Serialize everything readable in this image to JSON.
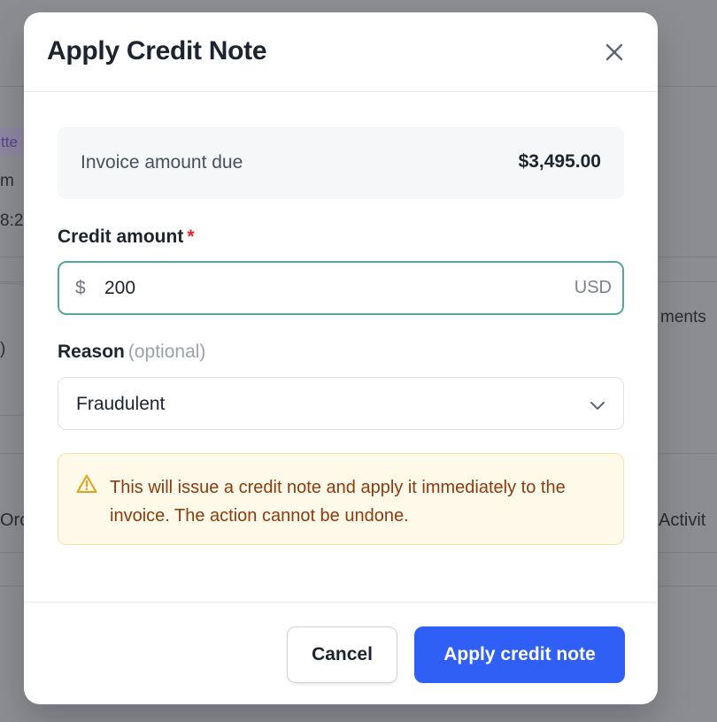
{
  "background": {
    "fragments": [
      "tte",
      "m",
      "8:2",
      ")",
      "Orc",
      "ments",
      "Activit"
    ]
  },
  "modal": {
    "title": "Apply Credit Note",
    "close_icon": "close-icon",
    "summary": {
      "label": "Invoice amount due",
      "value": "$3,495.00"
    },
    "credit_amount": {
      "label": "Credit amount",
      "required_marker": "*",
      "prefix": "$",
      "value": "200",
      "currency": "USD"
    },
    "reason": {
      "label": "Reason",
      "optional_hint": "(optional)",
      "selected": "Fraudulent"
    },
    "warning": {
      "icon": "warning-icon",
      "text": "This will issue a credit note and apply it immediately to the invoice. The action cannot be undone."
    },
    "footer": {
      "cancel_label": "Cancel",
      "submit_label": "Apply credit note"
    }
  },
  "colors": {
    "primary": "#2f5ff5",
    "focus_border": "#54a79c",
    "warning_text": "#8a3b0f",
    "warning_bg": "#fef9e8",
    "required": "#e1262d"
  }
}
